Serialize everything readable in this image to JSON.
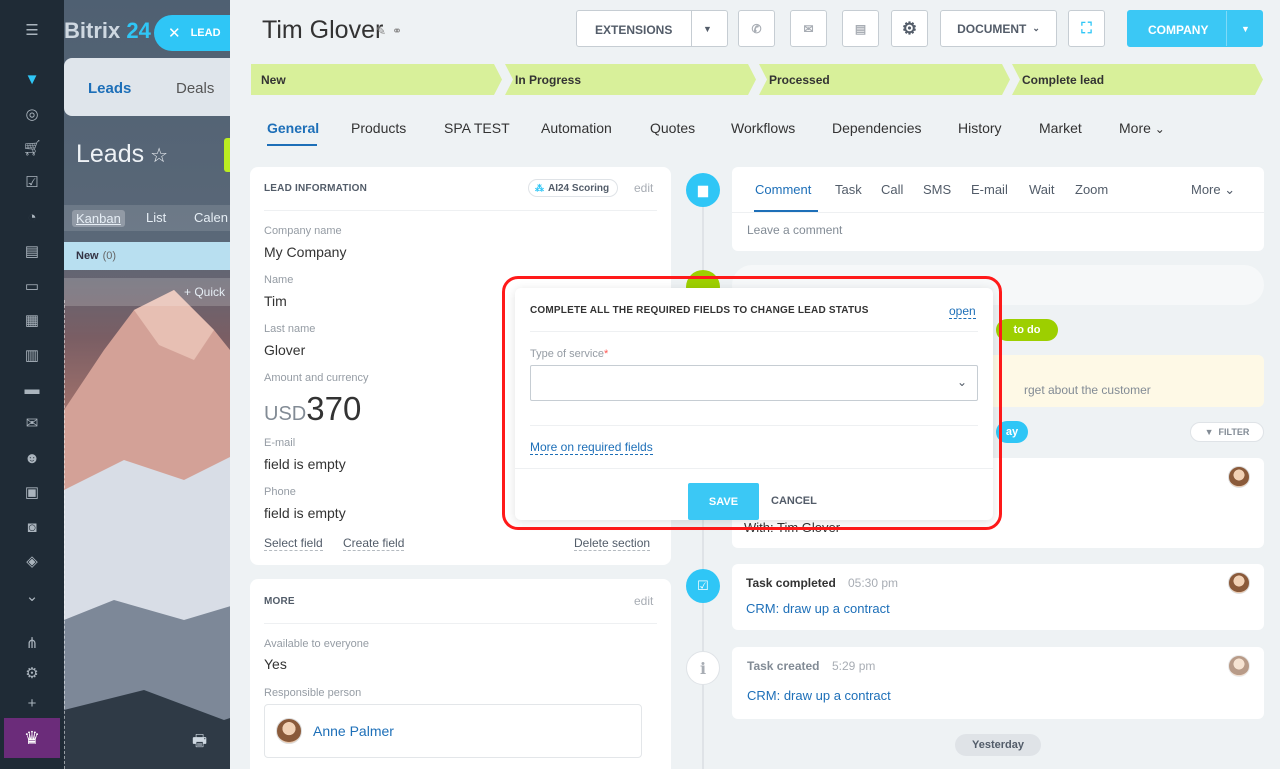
{
  "app": {
    "logo_text": "Bitrix",
    "logo_num": "24"
  },
  "sidebar_icons": [
    "menu-icon",
    "filter-icon",
    "target-icon",
    "cart-icon",
    "checkbox-icon",
    "pie-icon",
    "feed-icon",
    "chat-icon",
    "calendar-icon",
    "document-icon",
    "drive-icon",
    "mail-icon",
    "group-icon",
    "contact-card-icon",
    "robot-icon",
    "box-icon",
    "chevron-circle-icon",
    "sitemap-icon",
    "settings-icon",
    "plus-icon",
    "crown-icon"
  ],
  "background": {
    "tabs": [
      "Leads",
      "Deals"
    ],
    "title": "Leads",
    "views": [
      "Kanban",
      "List",
      "Calen"
    ],
    "column_name": "New",
    "column_count": "(0)",
    "quick_label": "+ Quick"
  },
  "lead_badge": "LEAD",
  "header": {
    "title": "Tim Glover",
    "extensions": "EXTENSIONS",
    "document": "DOCUMENT",
    "company": "COMPANY"
  },
  "stages": [
    "New",
    "In Progress",
    "Processed",
    "Complete lead"
  ],
  "tabs": [
    "General",
    "Products",
    "SPA TEST",
    "Automation",
    "Quotes",
    "Workflows",
    "Dependencies",
    "History",
    "Market",
    "More"
  ],
  "lead_info": {
    "heading": "LEAD INFORMATION",
    "ai_badge": "AI24 Scoring",
    "edit": "edit",
    "fields": [
      {
        "label": "Company name",
        "value": "My Company"
      },
      {
        "label": "Name",
        "value": "Tim"
      },
      {
        "label": "Last name",
        "value": "Glover"
      }
    ],
    "amount_label": "Amount and currency",
    "currency": "USD",
    "amount": "370",
    "email_label": "E-mail",
    "email_value": "field is empty",
    "phone_label": "Phone",
    "phone_value": "field is empty",
    "select_field": "Select field",
    "create_field": "Create field",
    "delete_section": "Delete section"
  },
  "more_section": {
    "heading": "MORE",
    "edit": "edit",
    "available_label": "Available to everyone",
    "available_value": "Yes",
    "responsible_label": "Responsible person",
    "responsible_name": "Anne Palmer"
  },
  "timeline": {
    "comment_tabs": [
      "Comment",
      "Task",
      "Call",
      "SMS",
      "E-mail",
      "Wait",
      "Zoom"
    ],
    "comment_more": "More",
    "comment_placeholder": "Leave a comment",
    "todo_pill": "to do",
    "reminder_partial": "rget about the customer",
    "today_pill_partial": "ay",
    "filter": "FILTER",
    "partial_event_text": "With: Tim Glover",
    "events": [
      {
        "title": "Task completed",
        "time": "05:30 pm",
        "link": "CRM: draw up a contract"
      },
      {
        "title": "Task created",
        "time": "5:29 pm",
        "link": "CRM: draw up a contract"
      }
    ],
    "yesterday": "Yesterday"
  },
  "modal": {
    "title": "COMPLETE ALL THE REQUIRED FIELDS TO CHANGE LEAD STATUS",
    "open": "open",
    "field_label": "Type of service",
    "required_mark": "*",
    "more_link": "More on required fields",
    "save": "SAVE",
    "cancel": "CANCEL"
  },
  "colors": {
    "accent": "#2fc6f6",
    "link": "#1d6fb8",
    "stage": "#d8f09a",
    "highlight": "#ff1a1a"
  }
}
